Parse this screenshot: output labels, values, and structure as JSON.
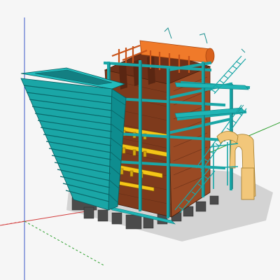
{
  "viewport": {
    "background": "#f6f6f6",
    "colors": {
      "hopper": "#1aa6a6",
      "hopper_dark": "#0c7d80",
      "frame": "#20b5b5",
      "casing": "#8a3f1e",
      "casing_dark": "#5a2612",
      "drum": "#f07a2a",
      "burner": "#f5c518",
      "duct": "#f2c77a",
      "foundation": "#4a4a4a",
      "shadow": "#cfcfcf",
      "axis_red": "#d23b3b",
      "axis_green": "#2fa02f",
      "axis_blue": "#3a58c8"
    }
  }
}
